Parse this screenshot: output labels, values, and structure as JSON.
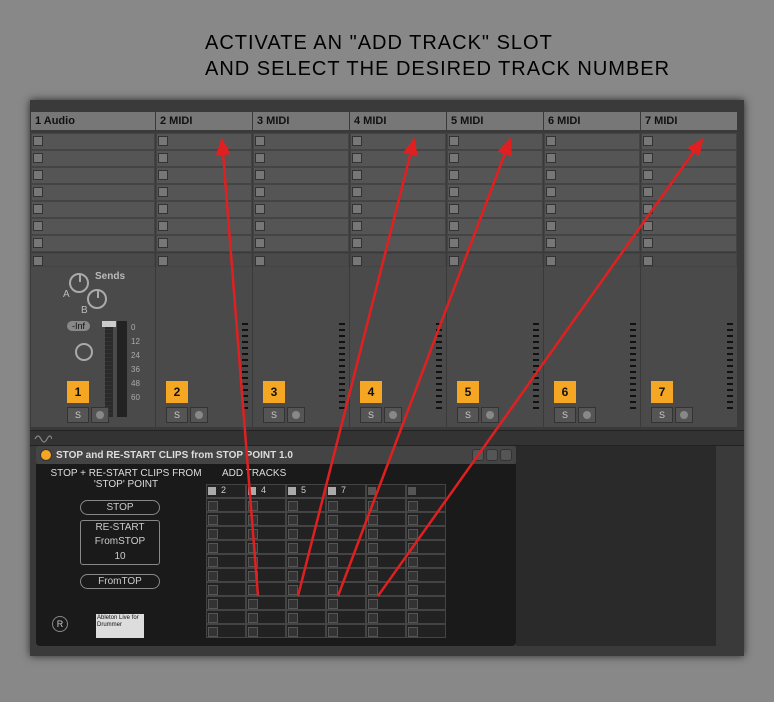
{
  "caption": {
    "line1": "ACTIVATE AN \"ADD TRACK\" SLOT",
    "line2": "AND SELECT THE DESIRED TRACK NUMBER"
  },
  "tracks": [
    {
      "name": "1 Audio",
      "num": "1",
      "solo": "S",
      "inf": "-Inf"
    },
    {
      "name": "2 MIDI",
      "num": "2",
      "solo": "S"
    },
    {
      "name": "3 MIDI",
      "num": "3",
      "solo": "S"
    },
    {
      "name": "4 MIDI",
      "num": "4",
      "solo": "S"
    },
    {
      "name": "5 MIDI",
      "num": "5",
      "solo": "S"
    },
    {
      "name": "6 MIDI",
      "num": "6",
      "solo": "S"
    },
    {
      "name": "7 MIDI",
      "num": "7",
      "solo": "S"
    }
  ],
  "sends": {
    "label": "Sends",
    "a": "A",
    "b": "B"
  },
  "db_ticks": [
    "0",
    "12",
    "24",
    "36",
    "48",
    "60"
  ],
  "device": {
    "title": "STOP and RE-START CLIPS from STOP POINT 1.0",
    "subtitle": "STOP + RE-START CLIPS FROM 'STOP' POINT",
    "add_tracks_label": "ADD TRACKS",
    "stop": "STOP",
    "restart": "RE-START",
    "fromstop": "FromSTOP",
    "ten": "10",
    "fromtop": "FromTOP",
    "r": "R",
    "logo": "Ableton Live for Drummer",
    "add_headers": [
      {
        "active": true,
        "num": "2"
      },
      {
        "active": true,
        "num": "4"
      },
      {
        "active": true,
        "num": "5"
      },
      {
        "active": true,
        "num": "7"
      },
      {
        "active": false,
        "num": ""
      },
      {
        "active": false,
        "num": ""
      }
    ],
    "add_rows": 10
  }
}
